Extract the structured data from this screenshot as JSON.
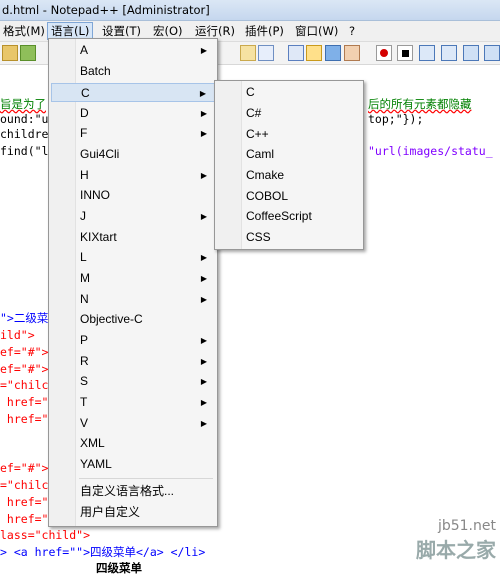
{
  "window": {
    "title": "d.html - Notepad++ [Administrator]"
  },
  "menubar": [
    {
      "label": "格式(M)"
    },
    {
      "label": "语言(L)"
    },
    {
      "label": "设置(T)"
    },
    {
      "label": "宏(O)"
    },
    {
      "label": "运行(R)"
    },
    {
      "label": "插件(P)"
    },
    {
      "label": "窗口(W)"
    },
    {
      "label": "?"
    }
  ],
  "editor": {
    "lines": [
      {
        "text": "旨是为了"
      },
      {
        "text": "ound:\"u"
      },
      {
        "text": "childre"
      },
      {
        "text": "find(\"l"
      },
      {
        "text": "后的所有元素都隐藏"
      },
      {
        "text": "top;\"});"
      },
      {
        "text": "\"url(images/statu_"
      },
      {
        "text": "\">二级菜"
      },
      {
        "text": "ild\">"
      },
      {
        "text": "ef=\"#\">"
      },
      {
        "text": "ef=\"#\">"
      },
      {
        "text": "=\"chilc"
      },
      {
        "text": " href=\""
      },
      {
        "text": " href=\""
      },
      {
        "text": "ef=\"#\">"
      },
      {
        "text": "=\"chilc"
      },
      {
        "text": " href=\""
      },
      {
        "text": " href=\""
      },
      {
        "text": "lass=\"child\">"
      },
      {
        "text": "> <a href=\"\">四级菜单</a> </li>"
      },
      {
        "text": "四级菜单"
      }
    ]
  },
  "language_menu": {
    "items": [
      {
        "label": "A",
        "submenu": true
      },
      {
        "label": "Batch",
        "submenu": false
      },
      {
        "label": "C",
        "submenu": true
      },
      {
        "label": "D",
        "submenu": true
      },
      {
        "label": "F",
        "submenu": true
      },
      {
        "label": "Gui4Cli",
        "submenu": false
      },
      {
        "label": "H",
        "submenu": true
      },
      {
        "label": "INNO",
        "submenu": false
      },
      {
        "label": "J",
        "submenu": true
      },
      {
        "label": "KIXtart",
        "submenu": false
      },
      {
        "label": "L",
        "submenu": true
      },
      {
        "label": "M",
        "submenu": true
      },
      {
        "label": "N",
        "submenu": true
      },
      {
        "label": "Objective-C",
        "submenu": false
      },
      {
        "label": "P",
        "submenu": true
      },
      {
        "label": "R",
        "submenu": true
      },
      {
        "label": "S",
        "submenu": true
      },
      {
        "label": "T",
        "submenu": true
      },
      {
        "label": "V",
        "submenu": true
      },
      {
        "label": "XML",
        "submenu": false
      },
      {
        "label": "YAML",
        "submenu": false
      }
    ],
    "extra": [
      {
        "label": "自定义语言格式..."
      },
      {
        "label": "用户自定义"
      }
    ]
  },
  "c_submenu": {
    "items": [
      {
        "label": "C"
      },
      {
        "label": "C#"
      },
      {
        "label": "C++"
      },
      {
        "label": "Caml"
      },
      {
        "label": "Cmake"
      },
      {
        "label": "COBOL"
      },
      {
        "label": "CoffeeScript"
      },
      {
        "label": "CSS"
      }
    ]
  },
  "watermark": {
    "line1": "jb51.net",
    "line2": "脚本之家"
  },
  "icons": [
    "open-file-icon",
    "save-icon",
    "copy-icon",
    "wrap-icon",
    "indent-guide-icon",
    "zoom-icon",
    "record-macro-icon",
    "stop-macro-icon",
    "play-macro-icon",
    "run-macro-icon",
    "save-macro-icon"
  ],
  "colors": {
    "menu_highlight": "#d8e5f3",
    "comment_green": "#008000",
    "tag_blue": "#0000ff"
  }
}
